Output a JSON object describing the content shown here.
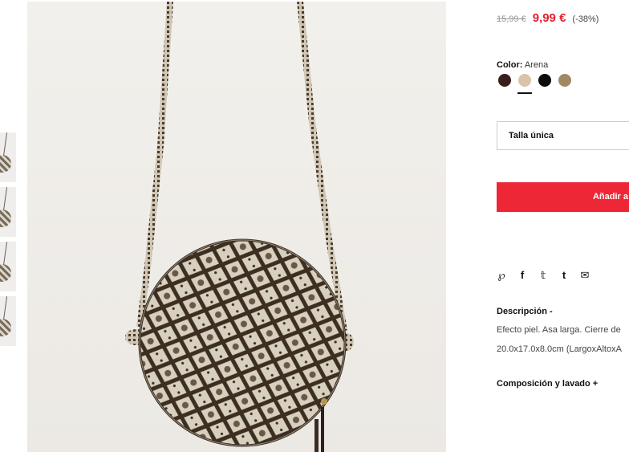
{
  "product": {
    "old_price": "15,99 €",
    "new_price": "9,99 €",
    "discount": "(-38%)",
    "color_label": "Color:",
    "color_value": "Arena",
    "swatches": [
      {
        "name": "dark-brown",
        "color": "#3a1e1c"
      },
      {
        "name": "arena",
        "color": "#d9c4aa"
      },
      {
        "name": "black",
        "color": "#0c0c0c"
      },
      {
        "name": "olive-tan",
        "color": "#a08a64"
      }
    ],
    "selected_swatch": 1,
    "size": "Talla única",
    "add_button": "Añadir a"
  },
  "share": {
    "icons": [
      "pinterest-icon",
      "facebook-icon",
      "twitter-icon",
      "tumblr-icon",
      "email-icon"
    ],
    "glyphs": [
      "ᵖ",
      "f",
      "t",
      "t",
      "✉"
    ]
  },
  "description": {
    "title": "Descripción -",
    "text": "Efecto piel. Asa larga. Cierre de",
    "dimensions": "20.0x17.0x8.0cm (LargoxAltoxA"
  },
  "composition": {
    "title": "Composición y lavado +"
  }
}
